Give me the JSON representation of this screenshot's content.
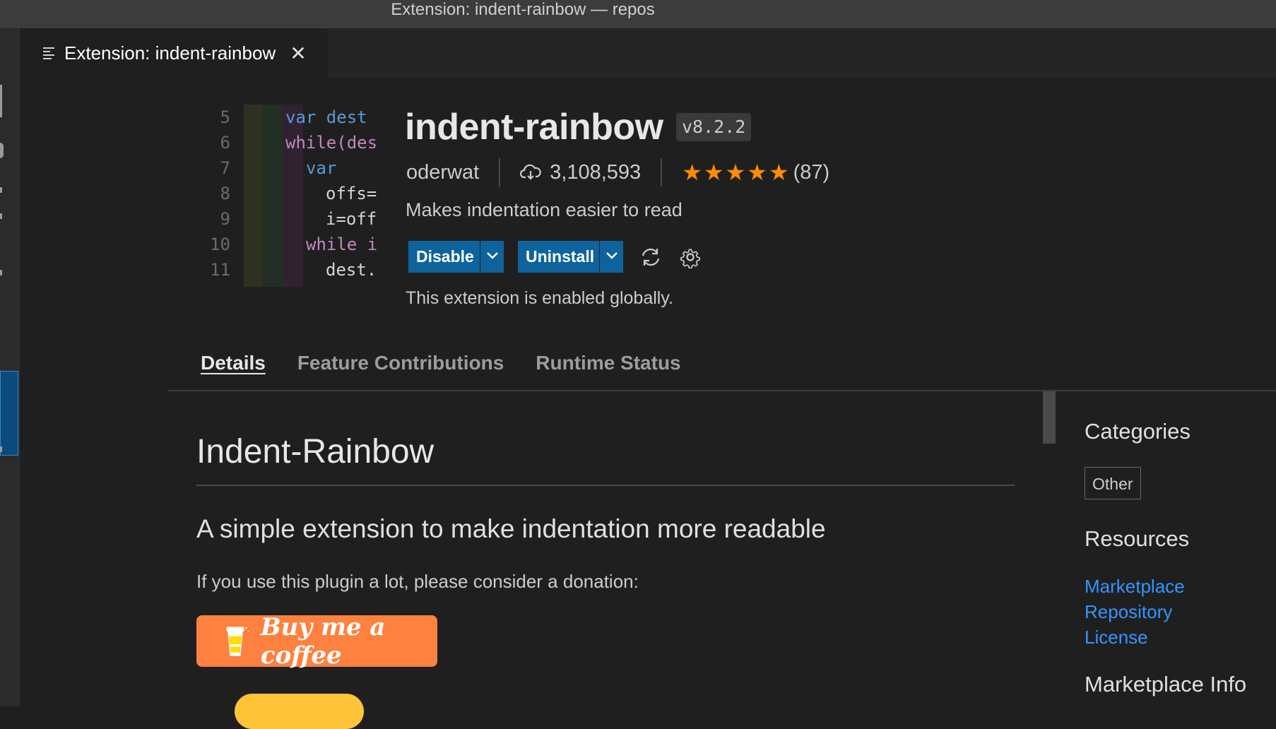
{
  "window": {
    "title": "Extension: indent-rainbow — repos"
  },
  "editor_tab": {
    "label": "Extension: indent-rainbow",
    "close_glyph": "✕",
    "icon": "preview-lines-icon"
  },
  "code_preview": {
    "line_numbers": [
      "5",
      "6",
      "7",
      "8",
      "9",
      "10",
      "11"
    ],
    "lines": [
      "var dest",
      "while(des",
      "var",
      "offs=",
      "i=off",
      "while i",
      "dest."
    ]
  },
  "extension": {
    "name": "indent-rainbow",
    "version": "v8.2.2",
    "publisher": "oderwat",
    "installs": "3,108,593",
    "rating_stars": "★★★★★",
    "rating_count": "(87)",
    "description": "Makes indentation easier to read",
    "status": "This extension is enabled globally."
  },
  "actions": {
    "disable_label": "Disable",
    "uninstall_label": "Uninstall",
    "button_color": "#0e639c"
  },
  "tabs": [
    "Details",
    "Feature Contributions",
    "Runtime Status"
  ],
  "readme": {
    "h1": "Indent-Rainbow",
    "h2": "A simple extension to make indentation more readable",
    "paragraph": "If you use this plugin a lot, please consider a donation:",
    "coffee_button": "Buy me a coffee"
  },
  "sidebar": {
    "categories_heading": "Categories",
    "category": "Other",
    "resources_heading": "Resources",
    "links": [
      "Marketplace",
      "Repository",
      "License"
    ],
    "marketplace_info_heading": "Marketplace Info"
  },
  "colors": {
    "star": "#ff8c00",
    "link": "#3794ff",
    "coffee": "#ff813f"
  }
}
